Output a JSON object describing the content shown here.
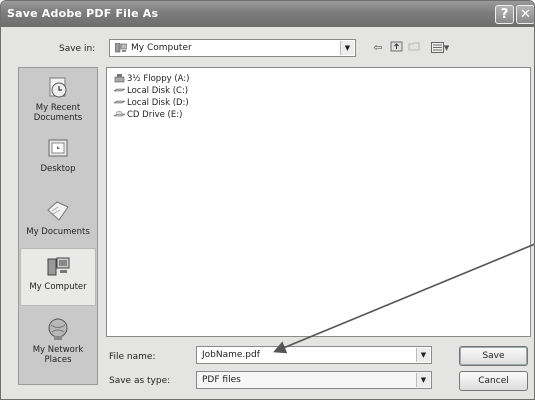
{
  "dialog": {
    "title": "Save Adobe PDF File As",
    "help_glyph": "?",
    "close_glyph": "✕"
  },
  "savein": {
    "label": "Save in:",
    "value": "My Computer"
  },
  "places": [
    {
      "label": "My Recent Documents",
      "icon": "recent-documents-icon",
      "selected": false
    },
    {
      "label": "Desktop",
      "icon": "desktop-icon",
      "selected": false
    },
    {
      "label": "My Documents",
      "icon": "my-documents-icon",
      "selected": false
    },
    {
      "label": "My Computer",
      "icon": "my-computer-icon",
      "selected": true
    },
    {
      "label": "My Network Places",
      "icon": "network-places-icon",
      "selected": false
    }
  ],
  "files": [
    {
      "label": "3½ Floppy (A:)",
      "icon": "floppy-drive-icon"
    },
    {
      "label": "Local Disk (C:)",
      "icon": "hard-drive-icon"
    },
    {
      "label": "Local Disk (D:)",
      "icon": "hard-drive-icon"
    },
    {
      "label": "CD Drive (E:)",
      "icon": "cd-drive-icon"
    }
  ],
  "filename": {
    "label": "File name:",
    "value": "JobName.pdf"
  },
  "savetype": {
    "label": "Save as type:",
    "value": "PDF files"
  },
  "buttons": {
    "save": "Save",
    "cancel": "Cancel"
  },
  "toolbar": {
    "back_glyph": "⇦",
    "views_glyph": "▾"
  }
}
